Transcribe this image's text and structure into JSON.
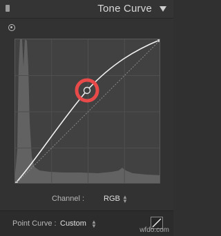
{
  "header": {
    "title": "Tone Curve"
  },
  "channel": {
    "label": "Channel :",
    "value": "RGB"
  },
  "point_curve": {
    "label": "Point Curve :",
    "value": "Custom"
  },
  "watermark": "wfdo.com",
  "colors": {
    "panel_bg": "#323232",
    "graph_bg": "#414141",
    "curve": "#f2f2f2",
    "highlight_ring": "#e84a4a"
  },
  "icons": {
    "collapse": "panel-handle-icon",
    "disclosure": "triangle-down-icon",
    "target": "targeted-adjustment-icon",
    "linear": "linear-curve-icon"
  }
}
